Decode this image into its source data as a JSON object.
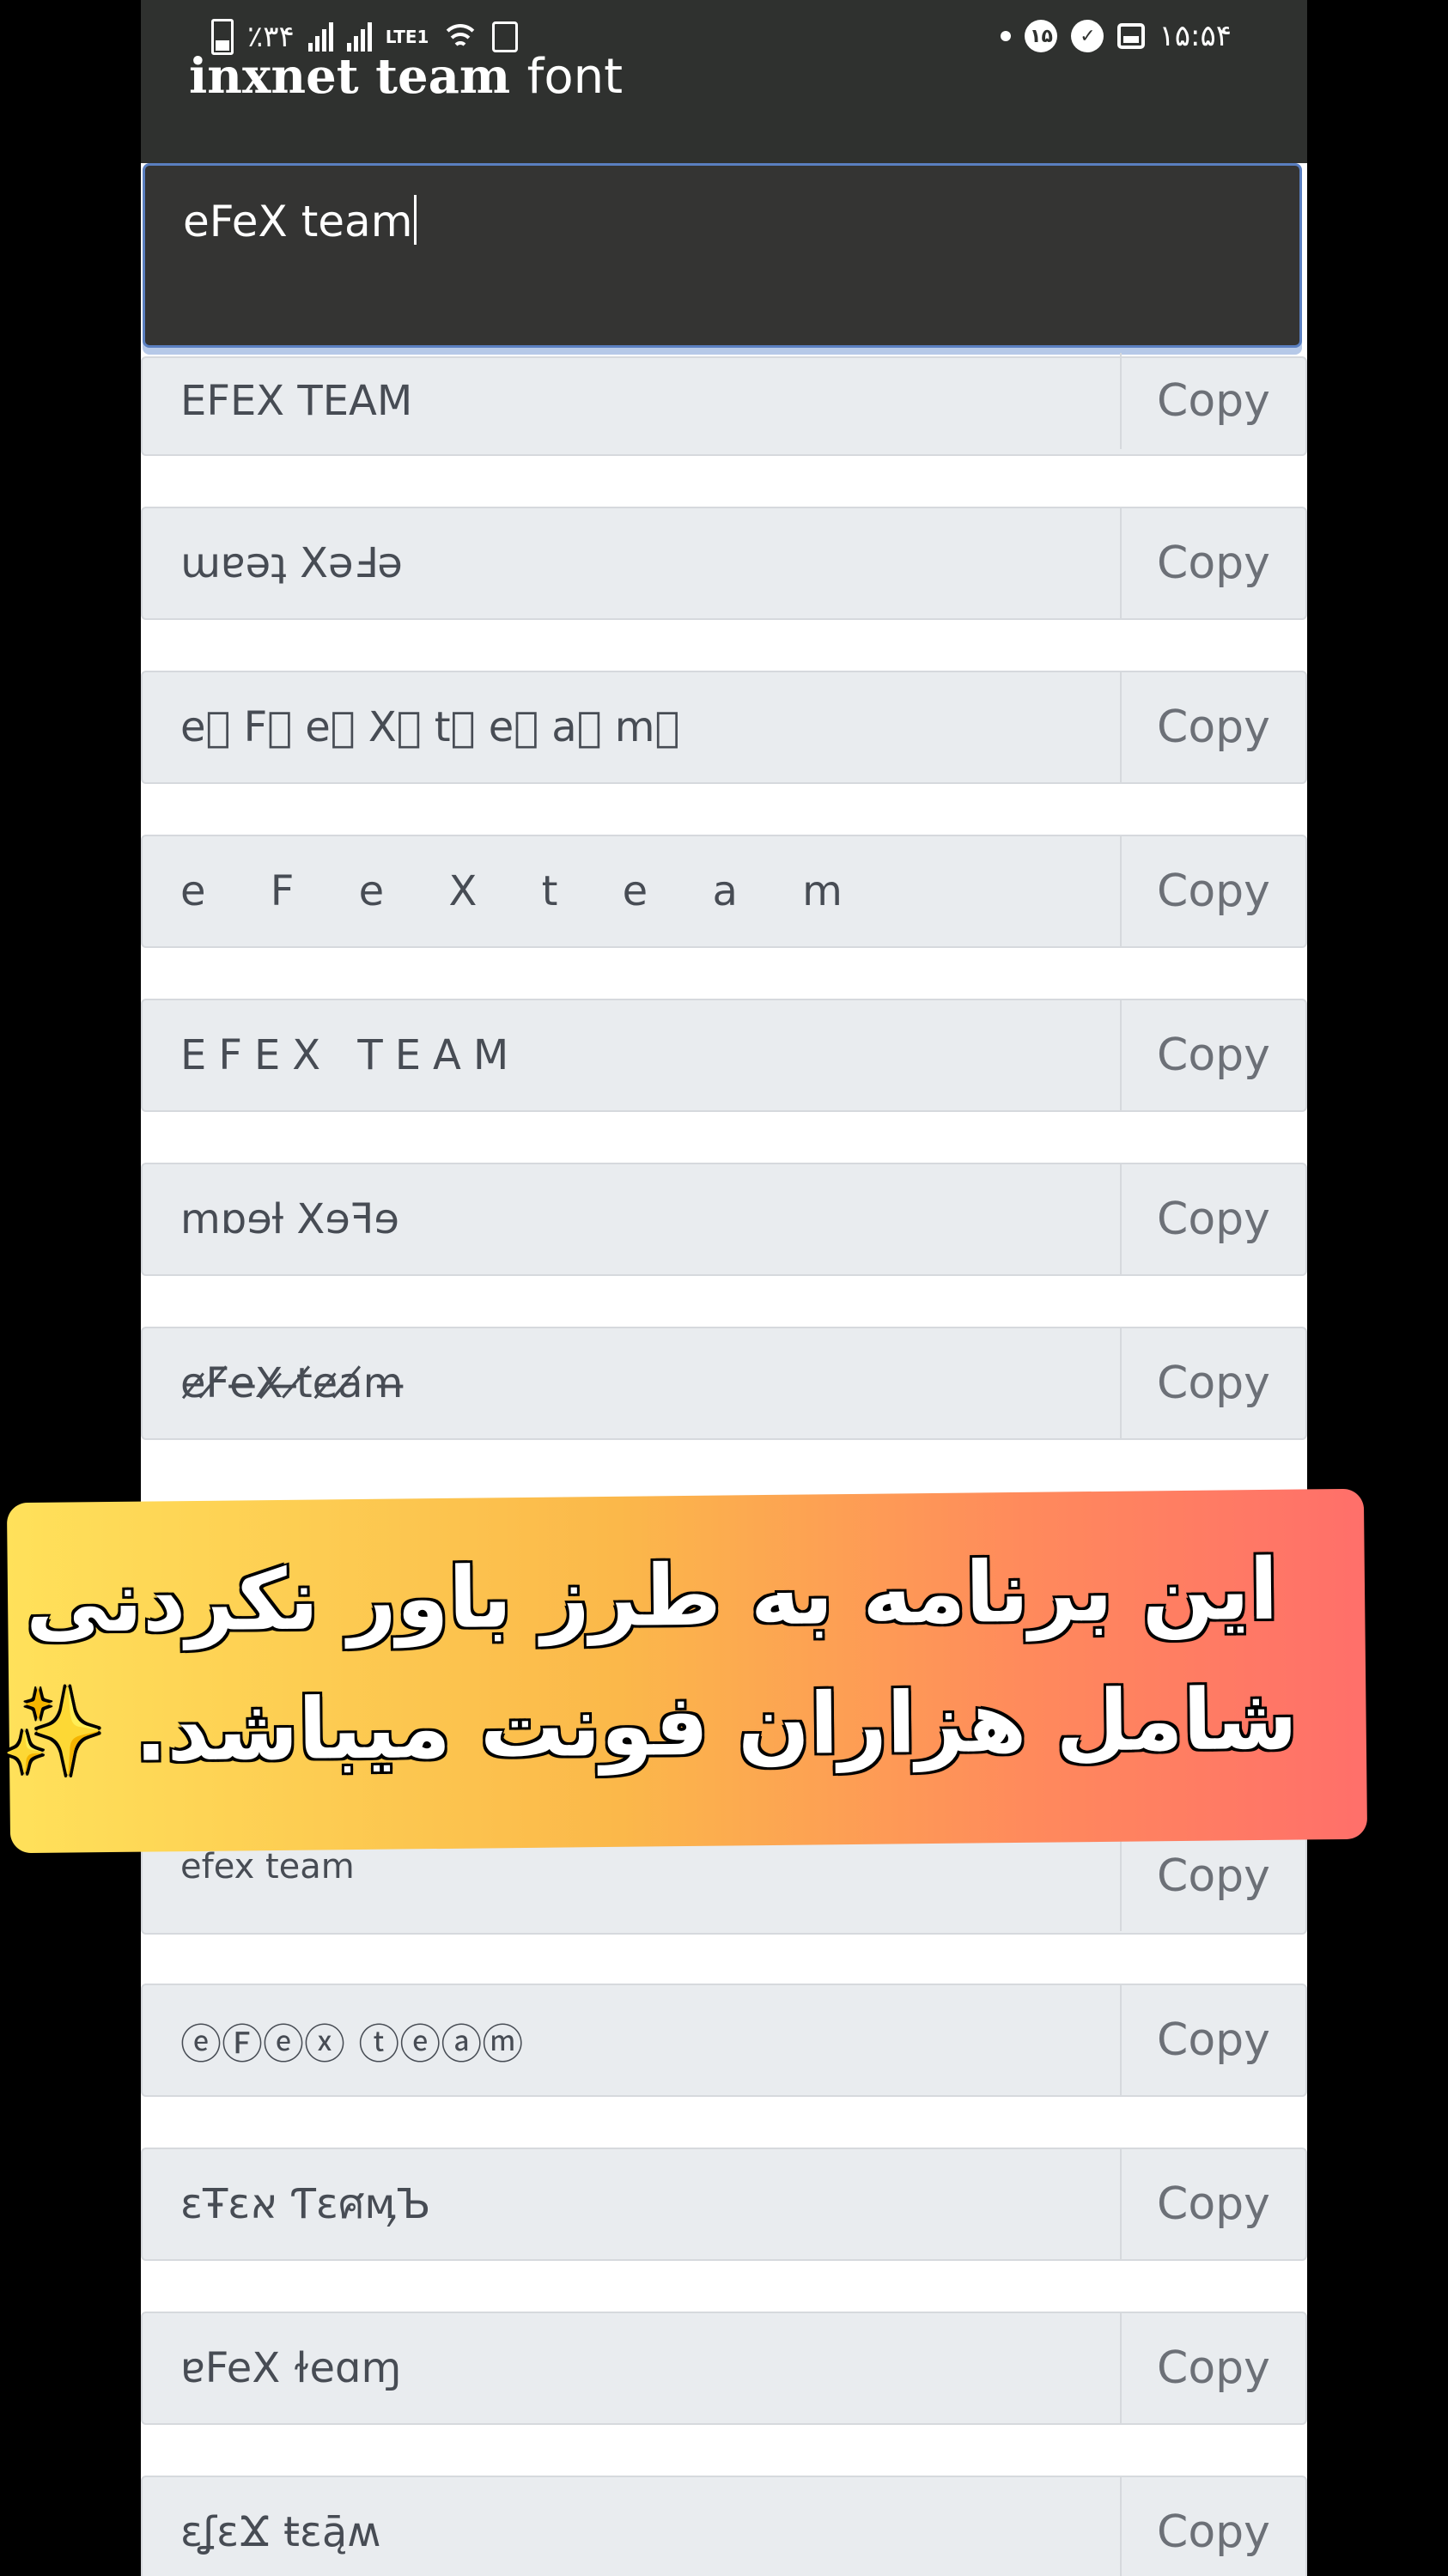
{
  "status_bar": {
    "battery": "٪۳۴",
    "network": "LTE1",
    "notification_count": "۱۵",
    "time": "۱۵:۵۴"
  },
  "app": {
    "title_bold": "inxnet team",
    "title_light": "font"
  },
  "input": {
    "value": "eFeX team"
  },
  "rows": [
    {
      "text": "EFEX TEAM",
      "copy": "Copy"
    },
    {
      "text": "ɯɐǝʇ XǝℲǝ",
      "copy": "Copy"
    },
    {
      "text": "e⃞  F⃞  e⃞  X⃞   t⃞  e⃞  a⃞  m⃞",
      "copy": "Copy"
    },
    {
      "text": "e F e X t e a m",
      "copy": "Copy"
    },
    {
      "text": "EFEX TEAM",
      "copy": "Copy"
    },
    {
      "text": "mɒɘƚ Xɘꟻɘ",
      "copy": "Copy"
    },
    {
      "text": "e̷F̸e̶X̷ ̶t̸e̷a̸m̶",
      "copy": "Copy"
    },
    {
      "text": "efex team",
      "copy": "Copy"
    },
    {
      "text": "ⓔⒻⓔⓧ ⓣⓔⓐⓜ",
      "copy": "Copy"
    },
    {
      "text": "ɛŦɛא ƬɛศӎЪ",
      "copy": "Copy"
    },
    {
      "text": "ɐFeX ɫeɑɱ",
      "copy": "Copy"
    },
    {
      "text": "ɛʆɛϪ ŧɛą̄ʍ",
      "copy": "Copy"
    }
  ],
  "banner": {
    "line1": "این برنامه به طرز باور نکردنی",
    "line2": "شامل هزاران فونت میباشد.",
    "emoji": "✨"
  }
}
